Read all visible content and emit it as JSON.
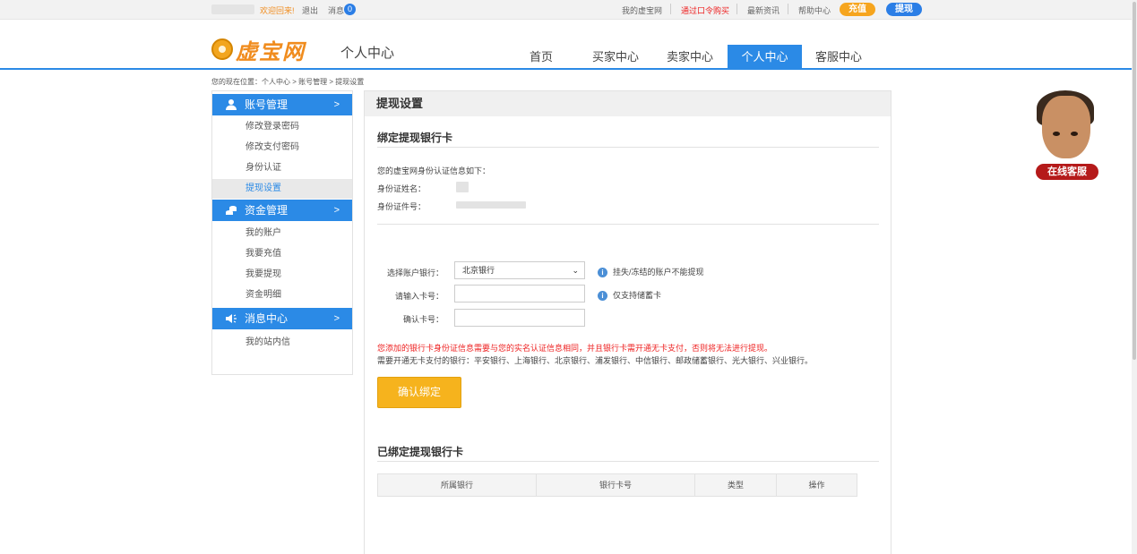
{
  "topbar": {
    "welcome": "欢迎回来!",
    "logout": "退出",
    "messages": "消息",
    "message_count": "0",
    "my_account": "我的虚宝网",
    "buy_via_code": "通过口令购买",
    "news": "最新资讯",
    "help": "帮助中心",
    "recharge": "充值",
    "withdraw": "提现"
  },
  "header": {
    "logo_text": "虚宝网",
    "section_title": "个人中心",
    "nav": [
      "首页",
      "买家中心",
      "卖家中心",
      "个人中心",
      "客服中心"
    ],
    "active_nav": "个人中心"
  },
  "breadcrumb": "您的现在位置：个人中心 > 账号管理 > 提现设置",
  "sidebar": {
    "groups": [
      {
        "title": "账号管理",
        "icon": "user-icon",
        "items": [
          "修改登录密码",
          "修改支付密码",
          "身份认证",
          "提现设置"
        ]
      },
      {
        "title": "资金管理",
        "icon": "coins-icon",
        "items": [
          "我的账户",
          "我要充值",
          "我要提现",
          "资金明细"
        ]
      },
      {
        "title": "消息中心",
        "icon": "speaker-icon",
        "items": [
          "我的站内信"
        ]
      }
    ],
    "active_item": "提现设置"
  },
  "main": {
    "title": "提现设置",
    "bind_title": "绑定提现银行卡",
    "identity_intro": "您的虚宝网身份认证信息如下：",
    "id_name_label": "身份证姓名：",
    "id_number_label": "身份证件号：",
    "form": {
      "bank_label": "选择账户银行：",
      "bank_selected": "北京银行",
      "card_label": "请输入卡号：",
      "confirm_label": "确认卡号：",
      "tip_bank": "挂失/冻结的账户不能提现",
      "tip_card": "仅支持储蓄卡"
    },
    "warning": "您添加的银行卡身份证信息需要与您的实名认证信息相同，并且银行卡需开通无卡支付，否则将无法进行提现。",
    "note": "需要开通无卡支付的银行：平安银行、上海银行、北京银行、浦发银行、中信银行、邮政储蓄银行、光大银行、兴业银行。",
    "submit": "确认绑定",
    "bound_title": "已绑定提现银行卡",
    "table_headers": [
      "所属银行",
      "银行卡号",
      "类型",
      "操作"
    ]
  },
  "customer_service": "在线客服",
  "colors": {
    "accent": "#2b8ae6",
    "orange": "#f6b31d",
    "warning": "#e22222"
  }
}
